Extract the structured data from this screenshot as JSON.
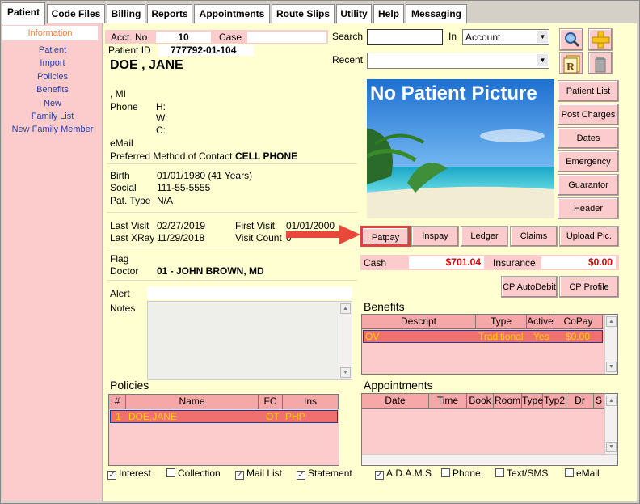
{
  "tabs": [
    "Patient",
    "Code Files",
    "Billing",
    "Reports",
    "Appointments",
    "Route Slips",
    "Utility",
    "Help",
    "Messaging"
  ],
  "sidebar": {
    "header": "Information",
    "items": [
      "Patient",
      "Import",
      "Policies",
      "Benefits",
      "New",
      "Family List",
      "New Family Member"
    ]
  },
  "patient": {
    "acct_label": "Acct. No",
    "acct_value": "10",
    "case_label": "Case",
    "case_value": "",
    "id_label": "Patient ID",
    "id_value": "777792-01-104",
    "name": "DOE , JANE",
    "mi": ", MI",
    "phone_label": "Phone",
    "phone_h": "H:",
    "phone_w": "W:",
    "phone_c": "C:",
    "email_label": "eMail",
    "contact_label": "Preferred Method of Contact",
    "contact_value": "CELL PHONE",
    "birth_label": "Birth",
    "birth_value": "01/01/1980 (41 Years)",
    "social_label": "Social",
    "social_value": "111-55-5555",
    "pattype_label": "Pat. Type",
    "pattype_value": "N/A",
    "lastvisit_label": "Last Visit",
    "lastvisit_value": "02/27/2019",
    "firstvisit_label": "First Visit",
    "firstvisit_value": "01/01/2000",
    "lastxray_label": "Last XRay",
    "lastxray_value": "11/29/2018",
    "visitcount_label": "Visit Count",
    "visitcount_value": "0",
    "flag_label": "Flag",
    "doctor_label": "Doctor",
    "doctor_value": "01 - JOHN BROWN, MD",
    "alert_label": "Alert",
    "notes_label": "Notes"
  },
  "search": {
    "label": "Search",
    "value": "",
    "in_label": "In",
    "in_value": "Account",
    "recent_label": "Recent",
    "recent_value": ""
  },
  "picture_text": "No Patient Picture",
  "side_buttons": [
    "Patient List",
    "Post Charges",
    "Dates",
    "Emergency",
    "Guarantor",
    "Header"
  ],
  "action_buttons": [
    "Patpay",
    "Inspay",
    "Ledger",
    "Claims",
    "Upload Pic."
  ],
  "cash_label": "Cash",
  "cash_value": "$701.04",
  "insurance_label": "Insurance",
  "insurance_value": "$0.00",
  "cp_buttons": [
    "CP AutoDebit",
    "CP Profile"
  ],
  "benefits": {
    "title": "Benefits",
    "columns": [
      "Descript",
      "Type",
      "Active",
      "CoPay"
    ],
    "rows": [
      [
        "OV",
        "Traditional",
        "Yes",
        "$0.00"
      ]
    ]
  },
  "policies": {
    "title": "Policies",
    "columns": [
      "#",
      "Name",
      "FC",
      "Ins"
    ],
    "rows": [
      [
        "1",
        "DOE,JANE",
        "OT",
        "PHP"
      ]
    ]
  },
  "appointments": {
    "title": "Appointments",
    "columns": [
      "Date",
      "Time",
      "Book",
      "Room",
      "Type",
      "Typ2",
      "Dr",
      "S"
    ]
  },
  "checkboxes_left": [
    {
      "label": "Interest",
      "checked": true
    },
    {
      "label": "Collection",
      "checked": false
    },
    {
      "label": "Mail List",
      "checked": true
    },
    {
      "label": "Statement",
      "checked": true
    }
  ],
  "checkboxes_right": [
    {
      "label": "A.D.A.M.S",
      "checked": true
    },
    {
      "label": "Phone",
      "checked": false
    },
    {
      "label": "Text/SMS",
      "checked": false
    },
    {
      "label": "eMail",
      "checked": false
    }
  ],
  "colors": {
    "pink": "#fccccc",
    "cream": "#ffffd2",
    "row_highlight": "#f07070",
    "row_text": "#ffd400",
    "money_red": "#e00000",
    "arrow": "#e8483a"
  }
}
